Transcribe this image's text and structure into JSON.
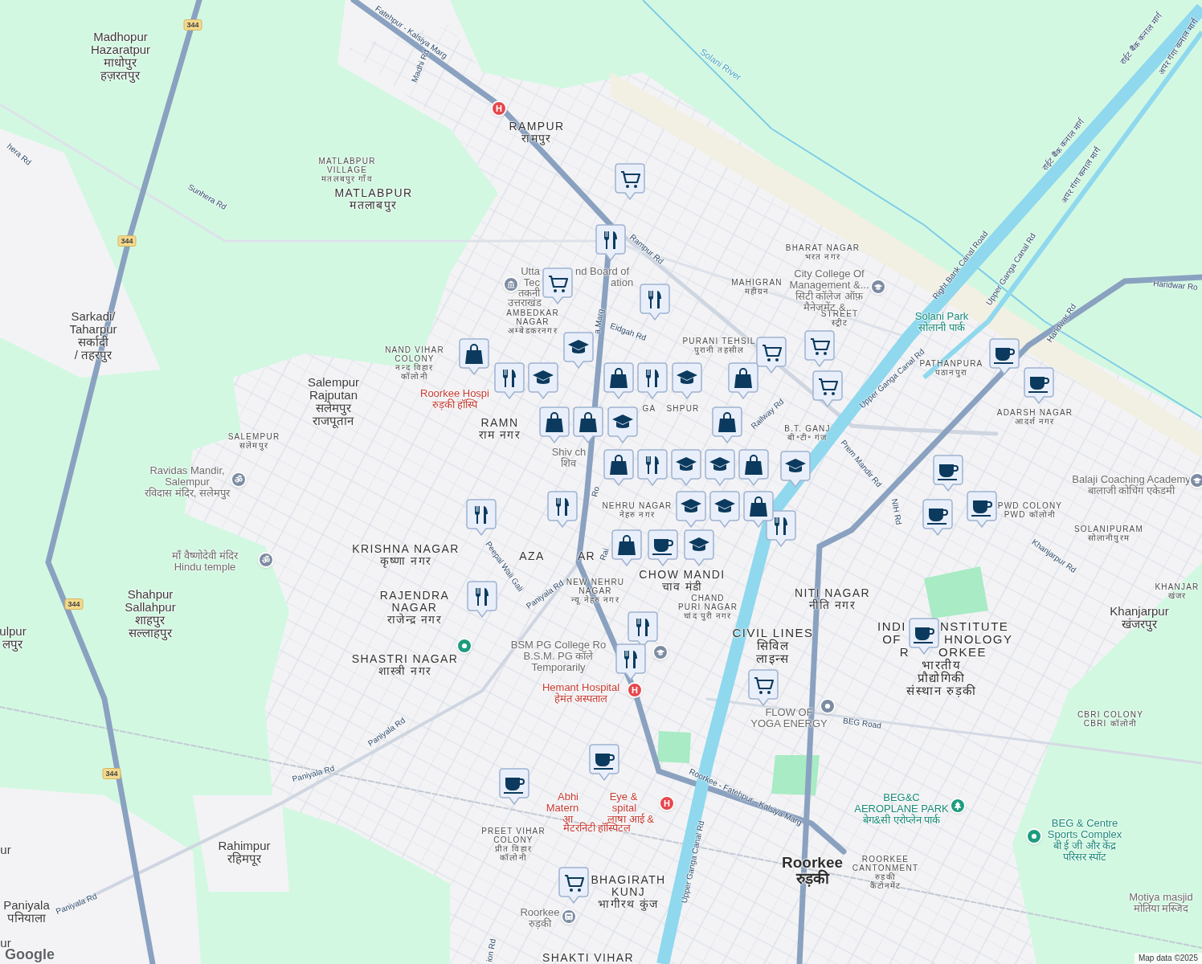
{
  "map": {
    "labels": [
      {
        "kind": "place",
        "lines": [
          "Madhopur",
          "Hazaratpur",
          "माधोपुर",
          "हज़रतपुर"
        ]
      },
      {
        "kind": "place",
        "lines": [
          "Sarkadi/",
          "Taharpur",
          "सर्कादी",
          "/ तहरपुर"
        ]
      },
      {
        "kind": "place",
        "lines": [
          "Salempur",
          "Rajputan",
          "सलेमपुर",
          "राजपूतान"
        ]
      },
      {
        "kind": "place",
        "lines": [
          "Shahpur",
          "Sallahpur",
          "शाहपुर",
          "सल्लाहपुर"
        ]
      },
      {
        "kind": "place",
        "lines": [
          "ulpur",
          "लपुर"
        ]
      },
      {
        "kind": "place",
        "lines": [
          "ur"
        ]
      },
      {
        "kind": "place",
        "lines": [
          "Rahimpur",
          "रहिमपूर"
        ]
      },
      {
        "kind": "place",
        "lines": [
          "Paniyala",
          "पनियाला"
        ]
      },
      {
        "kind": "place",
        "lines": [
          "ur"
        ]
      },
      {
        "kind": "place",
        "lines": [
          "Khanjarpur",
          "खंजरपुर"
        ]
      },
      {
        "kind": "town",
        "lines": [
          "Roorkee",
          "रुड़की"
        ]
      },
      {
        "kind": "area-lg",
        "lines": [
          "RAMPUR",
          "रामपुर"
        ]
      },
      {
        "kind": "area",
        "lines": [
          "MATLABPUR",
          "VILLAGE",
          "मतलबपुर गाँव"
        ]
      },
      {
        "kind": "area-lg",
        "lines": [
          "MATLABPUR",
          "मतलाबपुर"
        ]
      },
      {
        "kind": "area",
        "lines": [
          "AMBEDKAR",
          "NAGAR",
          "अम्बेडकरनगर"
        ]
      },
      {
        "kind": "area",
        "lines": [
          "NAND VIHAR",
          "COLONY",
          "नन्द विहार",
          "कॉलोनी"
        ]
      },
      {
        "kind": "area",
        "lines": [
          "SALEMPUR",
          "सलेमपुर"
        ]
      },
      {
        "kind": "area-lg",
        "lines": [
          "RAMN",
          "राम नगर"
        ]
      },
      {
        "kind": "area-lg",
        "lines": [
          "KRISHNA NAGAR",
          "कृष्णा नगर"
        ]
      },
      {
        "kind": "area-lg",
        "lines": [
          "RAJENDRA",
          "NAGAR",
          "राजेन्द्र नगर"
        ]
      },
      {
        "kind": "area-lg",
        "lines": [
          "SHASTRI NAGAR",
          "शास्त्री नगर"
        ]
      },
      {
        "kind": "area-lg",
        "lines": [
          "AZA"
        ]
      },
      {
        "kind": "area-lg",
        "lines": [
          "AR"
        ]
      },
      {
        "kind": "area",
        "lines": [
          "NEW NEHRU",
          "NAGAR",
          "न्यू नेहरु नगर"
        ]
      },
      {
        "kind": "area",
        "lines": [
          "NEHRU NAGAR",
          "नेहरु नगर"
        ]
      },
      {
        "kind": "area-lg",
        "lines": [
          "CHOW MANDI",
          "चाव मंडी"
        ]
      },
      {
        "kind": "area",
        "lines": [
          "CHAND",
          "PURI NAGAR",
          "चांद पुरी नगर"
        ]
      },
      {
        "kind": "area",
        "lines": [
          "GA"
        ]
      },
      {
        "kind": "area",
        "lines": [
          "SHPUR"
        ]
      },
      {
        "kind": "area",
        "lines": [
          "PURANI TEHSIL",
          "पुरानी तहसील"
        ]
      },
      {
        "kind": "area",
        "lines": [
          "MAHIGRAN",
          "महीग्रन"
        ]
      },
      {
        "kind": "area",
        "lines": [
          "BHARAT NAGAR",
          "भरत नगर"
        ]
      },
      {
        "kind": "area",
        "lines": [
          "STREET",
          "स्ट्रीट"
        ]
      },
      {
        "kind": "area",
        "lines": [
          "B.T. GANJ",
          "बी॰टी॰ गंज"
        ]
      },
      {
        "kind": "area",
        "lines": [
          "PATHANPURA",
          "पठानपुरा"
        ]
      },
      {
        "kind": "area",
        "lines": [
          "ADARSH NAGAR",
          "आदर्श नगर"
        ]
      },
      {
        "kind": "area",
        "lines": [
          "PWD COLONY",
          "PWD कॉलोनी"
        ]
      },
      {
        "kind": "area",
        "lines": [
          "SOLANIPURAM",
          "सोलानीपुरम"
        ]
      },
      {
        "kind": "area",
        "lines": [
          "KHANJAR",
          "खंजर"
        ]
      },
      {
        "kind": "area-lg",
        "lines": [
          "NITI NAGAR",
          "नीति नगर"
        ]
      },
      {
        "kind": "area-xl",
        "lines": [
          "CIVIL LINES",
          "सिविल",
          "लाइन्स"
        ]
      },
      {
        "kind": "area-xl",
        "lines": [
          "INDI"
        ]
      },
      {
        "kind": "area-xl",
        "lines": [
          "NSTITUTE"
        ]
      },
      {
        "kind": "area-xl",
        "lines": [
          "OF"
        ]
      },
      {
        "kind": "area-xl",
        "lines": [
          "HNOLOGY"
        ]
      },
      {
        "kind": "area-xl",
        "lines": [
          "R"
        ]
      },
      {
        "kind": "area-xl",
        "lines": [
          "ORKEE"
        ]
      },
      {
        "kind": "area-xl",
        "lines": [
          "भारतीय",
          "प्रौद्योगिकी",
          "संस्थान रुड़की"
        ]
      },
      {
        "kind": "area",
        "lines": [
          "CBRI COLONY",
          "CBRI कॉलोनी"
        ]
      },
      {
        "kind": "area",
        "lines": [
          "ROORKEE",
          "CANTONMENT",
          "रुड़की",
          "कैंटोनमेंट"
        ]
      },
      {
        "kind": "area",
        "lines": [
          "PREET VIHAR",
          "COLONY",
          "प्रीत विहार",
          "कॉलोनी"
        ]
      },
      {
        "kind": "area-lg",
        "lines": [
          "BHAGIRATH",
          "KUNJ",
          "भागीरथ कुंज"
        ]
      },
      {
        "kind": "area-lg",
        "lines": [
          "SHAKTI VIHAR"
        ]
      },
      {
        "kind": "poi-red",
        "lines": [
          "Roorkee Hospi",
          "रुड़की हॉस्पि"
        ]
      },
      {
        "kind": "poi-red",
        "lines": [
          "Hemant Hospital",
          "हेमंत अस्पताल"
        ]
      },
      {
        "kind": "poi-red",
        "lines": [
          "Abhi"
        ]
      },
      {
        "kind": "poi-red",
        "lines": [
          "Eye &"
        ]
      },
      {
        "kind": "poi-red",
        "lines": [
          "Matern"
        ]
      },
      {
        "kind": "poi-red",
        "lines": [
          "spital"
        ]
      },
      {
        "kind": "poi-red",
        "lines": [
          "आ"
        ]
      },
      {
        "kind": "poi-red",
        "lines": [
          "लाषा आई &"
        ]
      },
      {
        "kind": "poi-red",
        "lines": [
          "मैटरनिटी हॉस्पिटल"
        ]
      },
      {
        "kind": "poi-gray",
        "lines": [
          "Utta"
        ]
      },
      {
        "kind": "poi-gray",
        "lines": [
          "nd Board of"
        ]
      },
      {
        "kind": "poi-gray",
        "lines": [
          "Tec"
        ]
      },
      {
        "kind": "poi-gray",
        "lines": [
          "ation"
        ]
      },
      {
        "kind": "poi-gray",
        "lines": [
          "तकनी"
        ]
      },
      {
        "kind": "poi-gray",
        "lines": [
          "उत्तराखंड"
        ]
      },
      {
        "kind": "poi-gray",
        "lines": [
          "City College Of",
          "Management &...",
          "सिटी कॉलेज ऑफ़",
          "मैनेजमेंट &..."
        ]
      },
      {
        "kind": "poi-teal",
        "lines": [
          "Solani Park",
          "सोलानी पार्क"
        ]
      },
      {
        "kind": "poi-gray",
        "lines": [
          "Ravidas Mandir,",
          "Salempur",
          "रविदास मंदिर, सलेमपुर"
        ]
      },
      {
        "kind": "poi-gray",
        "lines": [
          "Balaji Coaching Academy",
          "बालाजी कोचिंग एकेडमी"
        ]
      },
      {
        "kind": "poi-gray",
        "lines": [
          "माँ वैष्णोदेवी मंदिर",
          "Hindu temple"
        ]
      },
      {
        "kind": "poi-gray",
        "lines": [
          "Shiv ch",
          "शिव"
        ]
      },
      {
        "kind": "poi-gray",
        "lines": [
          "BSM PG College Ro",
          "B.S.M. PG कॉले",
          "Temporarily"
        ]
      },
      {
        "kind": "poi-gray",
        "lines": [
          "FLOW OF",
          "YOGA ENERGY"
        ]
      },
      {
        "kind": "poi-teal",
        "lines": [
          "BEG&C",
          "AEROPLANE PARK",
          "बेग&सी एरोप्लेन पार्क"
        ]
      },
      {
        "kind": "poi-teal",
        "lines": [
          "BEG & Centre",
          "Sports Complex",
          "बी ई जी और केंद्र",
          "परिसर स्पॉट"
        ]
      },
      {
        "kind": "poi-gray",
        "lines": [
          "Motiya masjid",
          "मोतिया मस्जिद"
        ]
      },
      {
        "kind": "poi-gray",
        "lines": [
          "Roorkee",
          "रुड़की"
        ]
      },
      {
        "kind": "road",
        "lines": [
          "Fatehpur - Kalsiya Marg"
        ]
      },
      {
        "kind": "road",
        "lines": [
          "Madhi Rd"
        ]
      },
      {
        "kind": "road",
        "lines": [
          "Sunhera Rd"
        ]
      },
      {
        "kind": "road",
        "lines": [
          "hera Rd"
        ]
      },
      {
        "kind": "road",
        "lines": [
          "Rampur Rd"
        ]
      },
      {
        "kind": "road",
        "lines": [
          "Eidgah Rd"
        ]
      },
      {
        "kind": "road",
        "lines": [
          "a Marg"
        ]
      },
      {
        "kind": "road",
        "lines": [
          "Railway Rd"
        ]
      },
      {
        "kind": "road",
        "lines": [
          "Right Bank Canal Road"
        ]
      },
      {
        "kind": "road",
        "lines": [
          "Upper Ganga Canal Rd"
        ]
      },
      {
        "kind": "road",
        "lines": [
          "Upper Ganga Canal Rd"
        ]
      },
      {
        "kind": "road",
        "lines": [
          "Haridwar Rd"
        ]
      },
      {
        "kind": "road",
        "lines": [
          "Haridwar Ro"
        ]
      },
      {
        "kind": "road",
        "lines": [
          "राईट बैंक कनाल मार्ग"
        ]
      },
      {
        "kind": "road",
        "lines": [
          "अपर गंगा कनाल मार्ग"
        ]
      },
      {
        "kind": "road",
        "lines": [
          "राईट बैंक कनाल मार्ग"
        ]
      },
      {
        "kind": "road",
        "lines": [
          "अपर गंगा कनाल मार्ग"
        ]
      },
      {
        "kind": "road",
        "lines": [
          "Prem Mandir Rd"
        ]
      },
      {
        "kind": "road",
        "lines": [
          "NIH Rd"
        ]
      },
      {
        "kind": "road",
        "lines": [
          "Khanjarpur Rd"
        ]
      },
      {
        "kind": "road",
        "lines": [
          "Peepal Wali Gali"
        ]
      },
      {
        "kind": "road",
        "lines": [
          "Paniyala Rd"
        ]
      },
      {
        "kind": "road",
        "lines": [
          "Paniyala Rd"
        ]
      },
      {
        "kind": "road",
        "lines": [
          "Paniyala Rd"
        ]
      },
      {
        "kind": "road",
        "lines": [
          "Paniyala Rd"
        ]
      },
      {
        "kind": "road",
        "lines": [
          "Rai"
        ]
      },
      {
        "kind": "road",
        "lines": [
          "Ro"
        ]
      },
      {
        "kind": "road",
        "lines": [
          "Roorkee - Fatehpur - Kalsiya Marg"
        ]
      },
      {
        "kind": "road",
        "lines": [
          "BEG Road"
        ]
      },
      {
        "kind": "road",
        "lines": [
          "Upper Ganga Canal Rd"
        ]
      },
      {
        "kind": "road",
        "lines": [
          "ion Rd"
        ]
      },
      {
        "kind": "water",
        "lines": [
          "Solani River"
        ]
      },
      {
        "kind": "shield",
        "lines": [
          "344"
        ]
      },
      {
        "kind": "shield",
        "lines": [
          "344"
        ]
      },
      {
        "kind": "shield",
        "lines": [
          "344"
        ]
      },
      {
        "kind": "shield",
        "lines": [
          "344"
        ]
      }
    ],
    "poi_icons": [
      {
        "kind": "hospital",
        "glyph": "H"
      },
      {
        "kind": "hospital",
        "glyph": "H"
      },
      {
        "kind": "hospital",
        "glyph": "H"
      },
      {
        "kind": "institution"
      },
      {
        "kind": "college"
      },
      {
        "kind": "college"
      },
      {
        "kind": "college"
      },
      {
        "kind": "temple",
        "glyph": "ॐ"
      },
      {
        "kind": "temple",
        "glyph": "ॐ"
      },
      {
        "kind": "park"
      },
      {
        "kind": "pin-teal"
      },
      {
        "kind": "pin-teal"
      },
      {
        "kind": "pin-gray"
      },
      {
        "kind": "train"
      }
    ],
    "markers": [
      {
        "kind": "cart"
      },
      {
        "kind": "cart"
      },
      {
        "kind": "cart"
      },
      {
        "kind": "cart"
      },
      {
        "kind": "cart"
      },
      {
        "kind": "cart"
      },
      {
        "kind": "cart"
      },
      {
        "kind": "food"
      },
      {
        "kind": "food"
      },
      {
        "kind": "food"
      },
      {
        "kind": "food"
      },
      {
        "kind": "food"
      },
      {
        "kind": "food"
      },
      {
        "kind": "food"
      },
      {
        "kind": "food"
      },
      {
        "kind": "food"
      },
      {
        "kind": "food"
      },
      {
        "kind": "food"
      },
      {
        "kind": "school"
      },
      {
        "kind": "school"
      },
      {
        "kind": "school"
      },
      {
        "kind": "school"
      },
      {
        "kind": "school"
      },
      {
        "kind": "school"
      },
      {
        "kind": "school"
      },
      {
        "kind": "school"
      },
      {
        "kind": "school"
      },
      {
        "kind": "school"
      },
      {
        "kind": "bag"
      },
      {
        "kind": "bag"
      },
      {
        "kind": "bag"
      },
      {
        "kind": "bag"
      },
      {
        "kind": "bag"
      },
      {
        "kind": "bag"
      },
      {
        "kind": "bag"
      },
      {
        "kind": "bag"
      },
      {
        "kind": "bag"
      },
      {
        "kind": "bag"
      },
      {
        "kind": "cup"
      },
      {
        "kind": "cup"
      },
      {
        "kind": "cup"
      },
      {
        "kind": "cup"
      },
      {
        "kind": "cup"
      },
      {
        "kind": "cup"
      },
      {
        "kind": "cup"
      },
      {
        "kind": "cup"
      },
      {
        "kind": "cup"
      }
    ],
    "logo": "Google",
    "attribution": "Map data ©2025"
  }
}
